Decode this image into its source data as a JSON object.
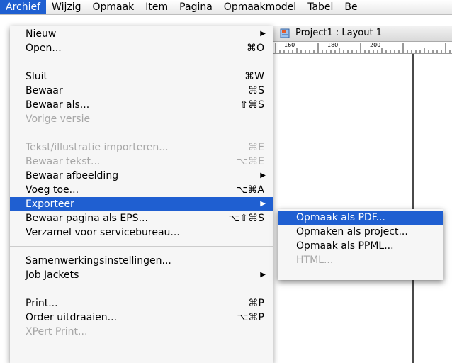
{
  "menubar": {
    "items": [
      {
        "label": "Archief",
        "active": true
      },
      {
        "label": "Wijzig"
      },
      {
        "label": "Opmaak"
      },
      {
        "label": "Item"
      },
      {
        "label": "Pagina"
      },
      {
        "label": "Opmaakmodel"
      },
      {
        "label": "Tabel"
      },
      {
        "label": "Be"
      }
    ]
  },
  "document": {
    "title": "Project1 : Layout 1",
    "ruler_labels": [
      "160",
      "180",
      "200"
    ]
  },
  "menu": {
    "items": [
      {
        "label": "Nieuw",
        "shortcut": "",
        "submenu": true,
        "disabled": false
      },
      {
        "label": "Open...",
        "shortcut": "⌘O",
        "submenu": false,
        "disabled": false
      },
      {
        "label": "Sluit",
        "shortcut": "⌘W",
        "submenu": false,
        "disabled": false
      },
      {
        "label": "Bewaar",
        "shortcut": "⌘S",
        "submenu": false,
        "disabled": false
      },
      {
        "label": "Bewaar als...",
        "shortcut": "⇧⌘S",
        "submenu": false,
        "disabled": false
      },
      {
        "label": "Vorige versie",
        "shortcut": "",
        "submenu": false,
        "disabled": true
      },
      {
        "label": "Tekst/illustratie importeren...",
        "shortcut": "⌘E",
        "submenu": false,
        "disabled": true
      },
      {
        "label": "Bewaar tekst...",
        "shortcut": "⌥⌘E",
        "submenu": false,
        "disabled": true
      },
      {
        "label": "Bewaar afbeelding",
        "shortcut": "",
        "submenu": true,
        "disabled": false
      },
      {
        "label": "Voeg toe...",
        "shortcut": "⌥⌘A",
        "submenu": false,
        "disabled": false
      },
      {
        "label": "Exporteer",
        "shortcut": "",
        "submenu": true,
        "disabled": false,
        "highlighted": true
      },
      {
        "label": "Bewaar pagina als EPS...",
        "shortcut": "⌥⇧⌘S",
        "submenu": false,
        "disabled": false
      },
      {
        "label": "Verzamel voor servicebureau...",
        "shortcut": "",
        "submenu": false,
        "disabled": false
      },
      {
        "label": "Samenwerkingsinstellingen...",
        "shortcut": "",
        "submenu": false,
        "disabled": false
      },
      {
        "label": "Job Jackets",
        "shortcut": "",
        "submenu": true,
        "disabled": false
      },
      {
        "label": "Print...",
        "shortcut": "⌘P",
        "submenu": false,
        "disabled": false
      },
      {
        "label": "Order uitdraaien...",
        "shortcut": "⌥⌘P",
        "submenu": false,
        "disabled": false
      },
      {
        "label": "XPert Print...",
        "shortcut": "",
        "submenu": false,
        "disabled": true
      }
    ]
  },
  "submenu": {
    "items": [
      {
        "label": "Opmaak als PDF...",
        "highlighted": true,
        "disabled": false
      },
      {
        "label": "Opmaken als project...",
        "disabled": false
      },
      {
        "label": "Opmaak als PPML...",
        "disabled": false
      },
      {
        "label": "HTML...",
        "disabled": true
      }
    ]
  }
}
